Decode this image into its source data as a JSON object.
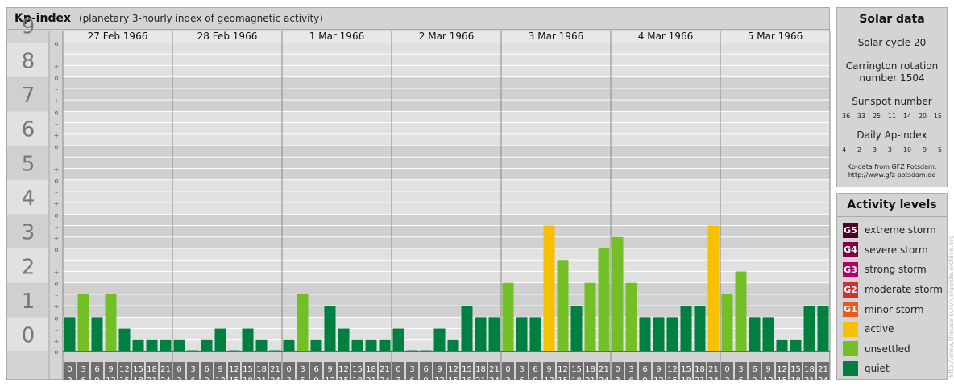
{
  "header": {
    "title": "Kp-index",
    "subtitle": "(planetary 3-hourly index of geomagnetic activity)"
  },
  "solar": {
    "heading": "Solar data",
    "cycle": "Solar cycle 20",
    "carrington_line1": "Carrington rotation",
    "carrington_line2": "number 1504",
    "sunspot_label": "Sunspot number",
    "sunspot_values": [
      "36",
      "33",
      "25",
      "11",
      "14",
      "20",
      "15"
    ],
    "ap_label": "Daily Ap-index",
    "ap_values": [
      "4",
      "2",
      "3",
      "3",
      "10",
      "9",
      "5"
    ],
    "source_line1": "Kp-data from GFZ Potsdam:",
    "source_line2": "http://www.gfz-potsdam.de"
  },
  "activity": {
    "heading": "Activity levels",
    "levels": [
      {
        "code": "G5",
        "label": "extreme storm",
        "color": "#4d0026"
      },
      {
        "code": "G4",
        "label": "severe storm",
        "color": "#800040"
      },
      {
        "code": "G3",
        "label": "strong storm",
        "color": "#b3005e"
      },
      {
        "code": "G2",
        "label": "moderate storm",
        "color": "#cc3333"
      },
      {
        "code": "G1",
        "label": "minor storm",
        "color": "#e65c1a"
      },
      {
        "code": "",
        "label": "active",
        "color": "#f7c000"
      },
      {
        "code": "",
        "label": "unsettled",
        "color": "#72bf26"
      },
      {
        "code": "",
        "label": "quiet",
        "color": "#008040"
      }
    ]
  },
  "watermark": "http://www.theusersurvivalguide.archive.org",
  "chart_data": {
    "type": "bar",
    "title": "Kp-index",
    "subtitle": "(planetary 3-hourly index of geomagnetic activity)",
    "ylim": [
      0,
      9
    ],
    "y_ticks": [
      "0",
      "1",
      "2",
      "3",
      "4",
      "5",
      "6",
      "7",
      "8",
      "9"
    ],
    "sub_tick_labels": [
      "+",
      "–",
      "o"
    ],
    "days": [
      "27 Feb 1966",
      "28 Feb 1966",
      "1 Mar 1966",
      "2 Mar 1966",
      "3 Mar 1966",
      "4 Mar 1966",
      "5 Mar 1966"
    ],
    "interval_start_labels": [
      "0",
      "3",
      "6",
      "9",
      "12",
      "15",
      "18",
      "21"
    ],
    "interval_end_labels": [
      "3",
      "6",
      "9",
      "12",
      "15",
      "18",
      "21",
      "24"
    ],
    "colors": {
      "quiet": "#008040",
      "unsettled": "#72bf26",
      "active": "#f7c000"
    },
    "values": [
      [
        1.0,
        1.667,
        1.0,
        1.667,
        0.667,
        0.333,
        0.333,
        0.333
      ],
      [
        0.333,
        0.0,
        0.333,
        0.667,
        0.0,
        0.667,
        0.333,
        0.0
      ],
      [
        0.333,
        1.667,
        0.333,
        1.333,
        0.667,
        0.333,
        0.333,
        0.333
      ],
      [
        0.667,
        0.0,
        0.0,
        0.667,
        0.333,
        1.333,
        1.0,
        1.0
      ],
      [
        2.0,
        1.0,
        1.0,
        3.667,
        2.667,
        1.333,
        2.0,
        3.0
      ],
      [
        3.333,
        2.0,
        1.0,
        1.0,
        1.0,
        1.333,
        1.333,
        3.667
      ],
      [
        1.667,
        2.333,
        1.0,
        1.0,
        0.333,
        0.333,
        1.333,
        1.333
      ]
    ]
  }
}
